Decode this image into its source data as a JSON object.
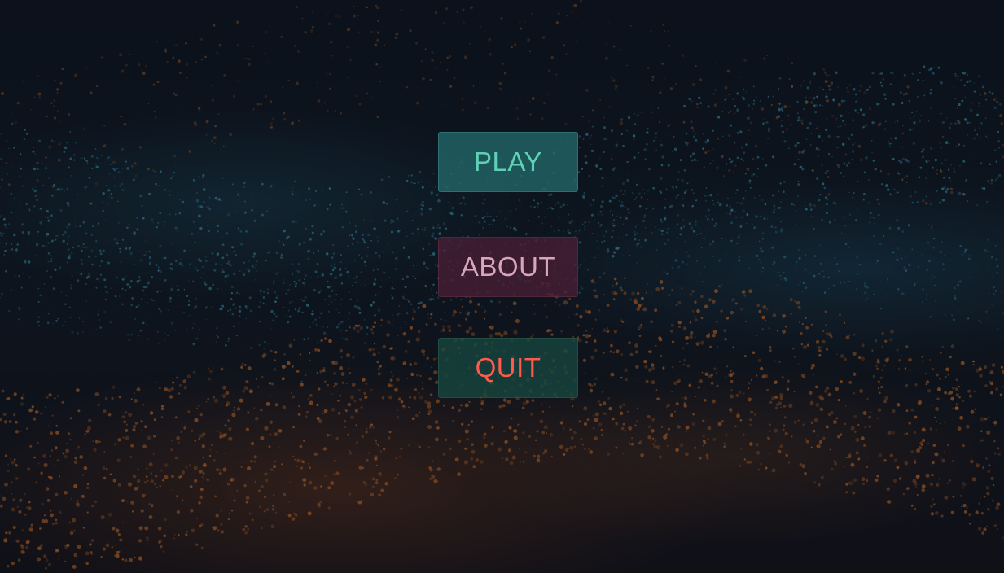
{
  "menu": {
    "play_label": "PLAY",
    "about_label": "ABOUT",
    "quit_label": "QUIT"
  },
  "background": {
    "description_icon": "particle-wave-background",
    "colors": {
      "base": "#0d121b",
      "teal_particles": "#3fa7c0",
      "orange_particles": "#d5742a"
    }
  },
  "colors": {
    "play_text": "#5fd0b5",
    "about_text": "#d8a6bc",
    "quit_text": "#ff5a4e"
  }
}
